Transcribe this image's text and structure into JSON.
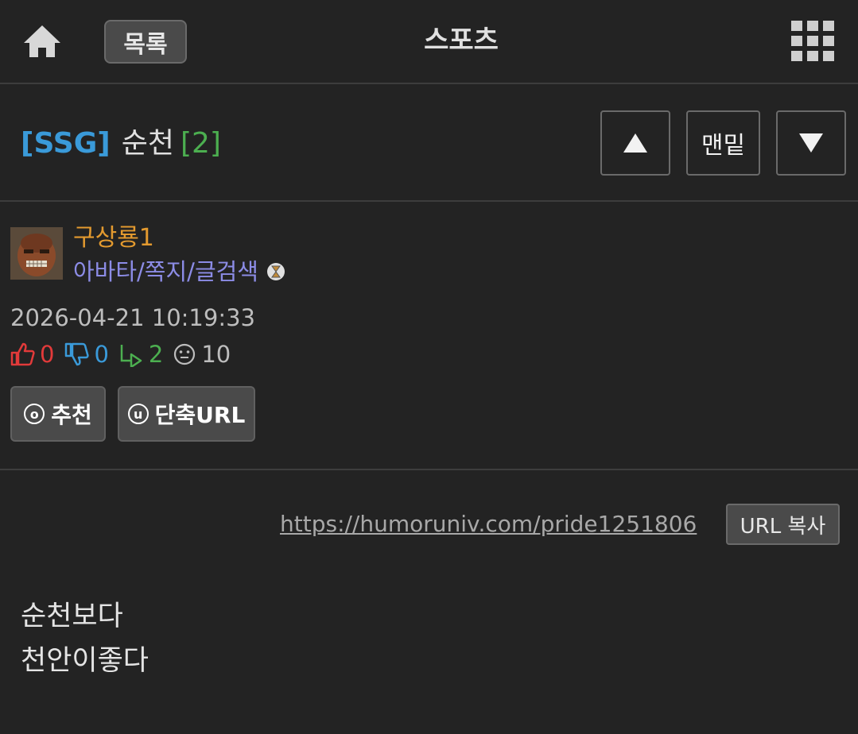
{
  "header": {
    "home_icon": "home-icon",
    "list_label": "목록",
    "board_title": "스포츠",
    "menu_icon": "grid-icon"
  },
  "post": {
    "category": "[SSG]",
    "title": "순천",
    "comment_count": "[2]",
    "nav": {
      "up_icon": "triangle-up-icon",
      "bottom_label": "맨밑",
      "down_icon": "triangle-down-icon"
    }
  },
  "author": {
    "nickname": "구상룡1",
    "menu": "아바타/쪽지/글검색",
    "date": "2026-04-21 10:19:33"
  },
  "stats": {
    "up": "0",
    "down": "0",
    "replies": "2",
    "views": "10"
  },
  "actions": {
    "recommend_icon_letter": "o",
    "recommend_label": "추천",
    "short_url_icon_letter": "u",
    "short_url_label": "단축URL"
  },
  "content": {
    "url": "https://humoruniv.com/pride1251806",
    "copy_label": "URL 복사",
    "lines": [
      "순천보다",
      "천안이좋다"
    ]
  },
  "colors": {
    "background": "#232323",
    "category": "#3a9ad9",
    "count": "#4caf50",
    "nickname": "#e39a2f",
    "menu_link": "#8c8ce6"
  }
}
